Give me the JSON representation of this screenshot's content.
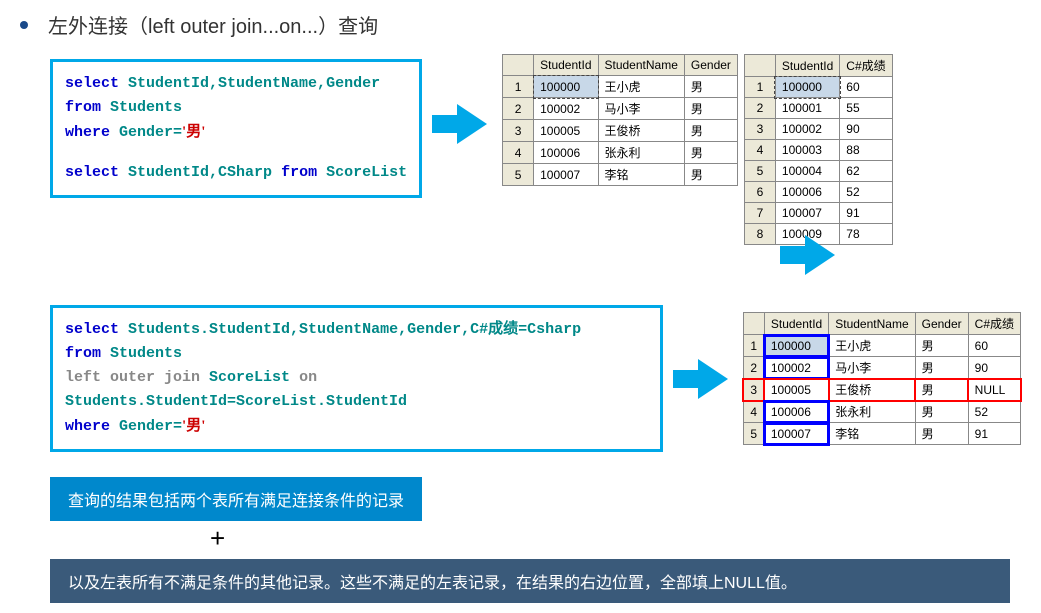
{
  "title": "左外连接（left outer join...on...）查询",
  "sql1": {
    "line1a": "select",
    "line1b": "StudentId,StudentName,Gender",
    "line2a": "from",
    "line2b": "Students",
    "line3a": "where",
    "line3b": "Gender=",
    "line3c": "'男'",
    "line4a": "select",
    "line4b": "StudentId,CSharp",
    "line4c": "from",
    "line4d": "ScoreList"
  },
  "table1": {
    "headers": [
      "StudentId",
      "StudentName",
      "Gender"
    ],
    "rows": [
      [
        "100000",
        "王小虎",
        "男"
      ],
      [
        "100002",
        "马小李",
        "男"
      ],
      [
        "100005",
        "王俊桥",
        "男"
      ],
      [
        "100006",
        "张永利",
        "男"
      ],
      [
        "100007",
        "李铭",
        "男"
      ]
    ]
  },
  "table2": {
    "headers": [
      "StudentId",
      "C#成绩"
    ],
    "rows": [
      [
        "100000",
        "60"
      ],
      [
        "100001",
        "55"
      ],
      [
        "100002",
        "90"
      ],
      [
        "100003",
        "88"
      ],
      [
        "100004",
        "62"
      ],
      [
        "100006",
        "52"
      ],
      [
        "100007",
        "91"
      ],
      [
        "100009",
        "78"
      ]
    ]
  },
  "sql2": {
    "l1a": "select",
    "l1b": "Students.StudentId,StudentName,Gender,C#",
    "l1c": "成绩",
    "l1d": "=Csharp",
    "l2a": "from",
    "l2b": "Students",
    "l3a": "left outer join",
    "l3b": "ScoreList",
    "l3c": "on",
    "l3d": "Students.StudentId=ScoreList.StudentId",
    "l4a": "where",
    "l4b": "Gender=",
    "l4c": "'男'"
  },
  "table3": {
    "headers": [
      "StudentId",
      "StudentName",
      "Gender",
      "C#成绩"
    ],
    "rows": [
      [
        "100000",
        "王小虎",
        "男",
        "60"
      ],
      [
        "100002",
        "马小李",
        "男",
        "90"
      ],
      [
        "100005",
        "王俊桥",
        "男",
        "NULL"
      ],
      [
        "100006",
        "张永利",
        "男",
        "52"
      ],
      [
        "100007",
        "李铭",
        "男",
        "91"
      ]
    ]
  },
  "note1": "查询的结果包括两个表所有满足连接条件的记录",
  "plus": "+",
  "note2": "以及左表所有不满足条件的其他记录。这些不满足的左表记录，在结果的右边位置，全部填上NULL值。"
}
